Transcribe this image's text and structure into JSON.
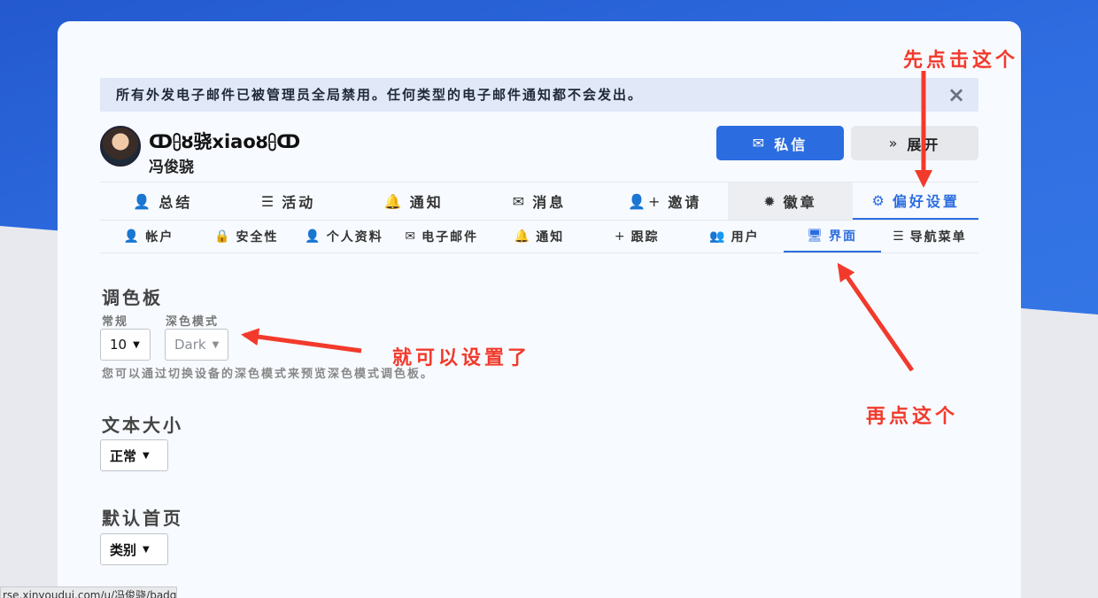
{
  "banner": {
    "text": "所有外发电子邮件已被管理员全局禁用。任何类型的电子邮件通知都不会发出。",
    "close_icon": "×"
  },
  "profile": {
    "username": "ↀ⩉ȣ骁xiaoȣ⩉ↀ",
    "real_name": "冯俊骁"
  },
  "actions": {
    "message_label": "私信",
    "expand_label": "展开"
  },
  "tabs": [
    {
      "label": "总结",
      "icon": "user-icon"
    },
    {
      "label": "活动",
      "icon": "list-icon"
    },
    {
      "label": "通知",
      "icon": "bell-icon"
    },
    {
      "label": "消息",
      "icon": "envelope-icon"
    },
    {
      "label": "邀请",
      "icon": "user-plus-icon"
    },
    {
      "label": "徽章",
      "icon": "badge-icon"
    },
    {
      "label": "偏好设置",
      "icon": "gear-icon"
    }
  ],
  "subtabs": [
    {
      "label": "帐户",
      "icon": "user-icon"
    },
    {
      "label": "安全性",
      "icon": "lock-icon"
    },
    {
      "label": "个人资料",
      "icon": "user-icon"
    },
    {
      "label": "电子邮件",
      "icon": "envelope-icon"
    },
    {
      "label": "通知",
      "icon": "bell-icon"
    },
    {
      "label": "跟踪",
      "icon": "plus-icon"
    },
    {
      "label": "用户",
      "icon": "users-icon"
    },
    {
      "label": "界面",
      "icon": "desktop-icon"
    },
    {
      "label": "导航菜单",
      "icon": "list-icon"
    }
  ],
  "palette": {
    "title": "调色板",
    "regular_label": "常规",
    "regular_value": "10",
    "dark_label": "深色模式",
    "dark_value": "Dark",
    "hint": "您可以通过切换设备的深色模式来预览深色模式调色板。"
  },
  "text_size": {
    "title": "文本大小",
    "value": "正常"
  },
  "default_home": {
    "title": "默认首页",
    "value": "类别"
  },
  "annotations": {
    "first": "先点击这个",
    "then": "再点这个",
    "done": "就可以设置了"
  },
  "status_url": "rse.xinyoudui.com/u/冯俊骁/badges",
  "colors": {
    "accent": "#2b6de0",
    "annotation": "#f23a2c",
    "background": "#2f6ee2"
  }
}
